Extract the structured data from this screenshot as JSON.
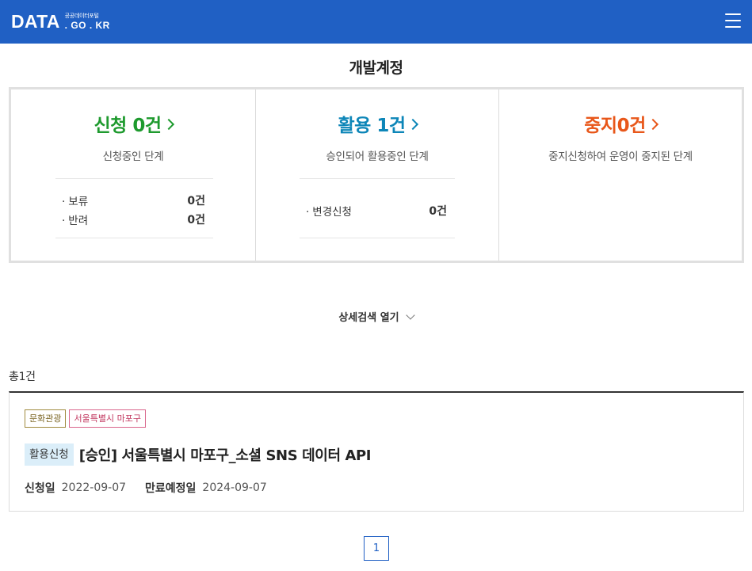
{
  "header": {
    "logo_main": "DATA",
    "logo_kr": "공공데이터포털",
    "logo_domain": ". GO . KR",
    "menu_icon": "hamburger-menu-icon",
    "background_color": "#2060c4"
  },
  "page_title": "개발계정",
  "summary": {
    "apply": {
      "title": "신청 0건",
      "description": "신청중인 단계",
      "color": "#1e9a2e",
      "items": [
        {
          "label": "보류",
          "value": "0건"
        },
        {
          "label": "반려",
          "value": "0건"
        }
      ]
    },
    "use": {
      "title": "활용 1건",
      "description": "승인되어 활용중인 단계",
      "color": "#0d86b8",
      "items": [
        {
          "label": "변경신청",
          "value": "0건"
        }
      ]
    },
    "stop": {
      "title": "중지0건",
      "description": "중지신청하여 운영이 중지된 단계",
      "color": "#e8571a"
    }
  },
  "search_toggle": "상세검색 열기",
  "total": "총1건",
  "results": [
    {
      "tags": [
        "문화관광",
        "서울특별시 마포구"
      ],
      "status": "활용신청",
      "title": "[승인] 서울특별시 마포구_소셜 SNS 데이터 API",
      "applied_label": "신청일",
      "applied_date": "2022-09-07",
      "expire_label": "만료예정일",
      "expire_date": "2024-09-07"
    }
  ],
  "pagination": {
    "current": "1"
  }
}
